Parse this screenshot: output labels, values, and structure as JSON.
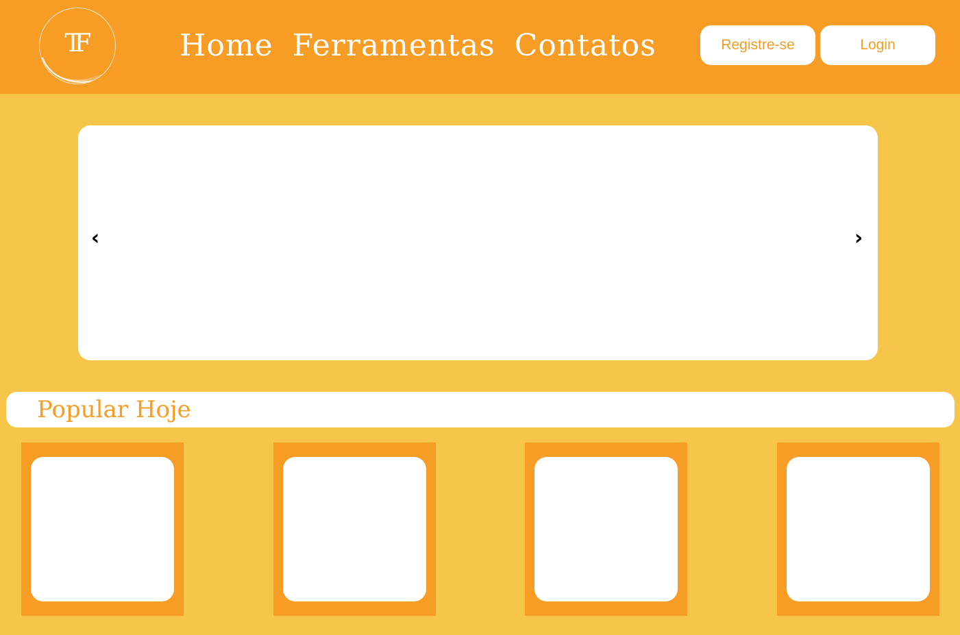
{
  "colors": {
    "header_bg": "#F79C25",
    "page_bg": "#F8C54B",
    "accent": "#F79C25",
    "surface": "#FFFFFF"
  },
  "logo": {
    "text": "TF"
  },
  "nav": {
    "items": [
      "Home",
      "Ferramentas",
      "Contatos"
    ]
  },
  "auth": {
    "register_label": "Registre-se",
    "login_label": "Login"
  },
  "carousel": {
    "prev_icon": "chevron-left-icon",
    "next_icon": "chevron-right-icon",
    "prev_glyph": "‹",
    "next_glyph": "›"
  },
  "popular": {
    "title": "Popular Hoje",
    "cards": [
      {},
      {},
      {},
      {}
    ]
  }
}
